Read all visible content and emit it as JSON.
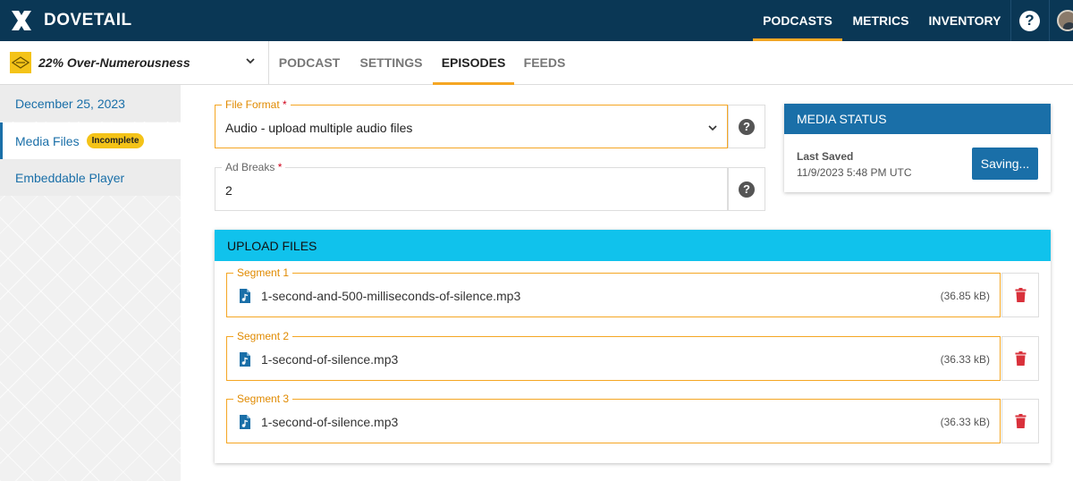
{
  "brand": {
    "name": "DOVETAIL"
  },
  "top_nav": [
    {
      "label": "PODCASTS",
      "active": true
    },
    {
      "label": "METRICS",
      "active": false
    },
    {
      "label": "INVENTORY",
      "active": false
    }
  ],
  "help": {
    "glyph": "?"
  },
  "podcast_selector": {
    "name": "22% Over-Numerousness"
  },
  "sub_tabs": [
    {
      "label": "PODCAST",
      "active": false
    },
    {
      "label": "SETTINGS",
      "active": false
    },
    {
      "label": "EPISODES",
      "active": true
    },
    {
      "label": "FEEDS",
      "active": false
    }
  ],
  "sidebar": {
    "items": [
      {
        "label": "December 25, 2023",
        "active": false
      },
      {
        "label": "Media Files",
        "active": true,
        "badge": "Incomplete"
      },
      {
        "label": "Embeddable Player",
        "active": false
      }
    ]
  },
  "form": {
    "file_format": {
      "label": "File Format",
      "required_mark": "*",
      "value": "Audio - upload multiple audio files"
    },
    "ad_breaks": {
      "label": "Ad Breaks",
      "required_mark": "*",
      "value": "2"
    }
  },
  "media_status": {
    "title": "MEDIA STATUS",
    "last_saved_label": "Last Saved",
    "last_saved_time": "11/9/2023 5:48 PM UTC",
    "button_label": "Saving..."
  },
  "upload": {
    "title": "UPLOAD FILES",
    "segments": [
      {
        "label": "Segment 1",
        "file": "1-second-and-500-milliseconds-of-silence.mp3",
        "size": "(36.85 kB)"
      },
      {
        "label": "Segment 2",
        "file": "1-second-of-silence.mp3",
        "size": "(36.33 kB)"
      },
      {
        "label": "Segment 3",
        "file": "1-second-of-silence.mp3",
        "size": "(36.33 kB)"
      }
    ]
  },
  "colors": {
    "topbar": "#0a3755",
    "accent": "#f5a623",
    "primary": "#1a6fa8",
    "upload_header": "#10c2ec",
    "danger": "#d9313b",
    "badge": "#f4c318"
  }
}
